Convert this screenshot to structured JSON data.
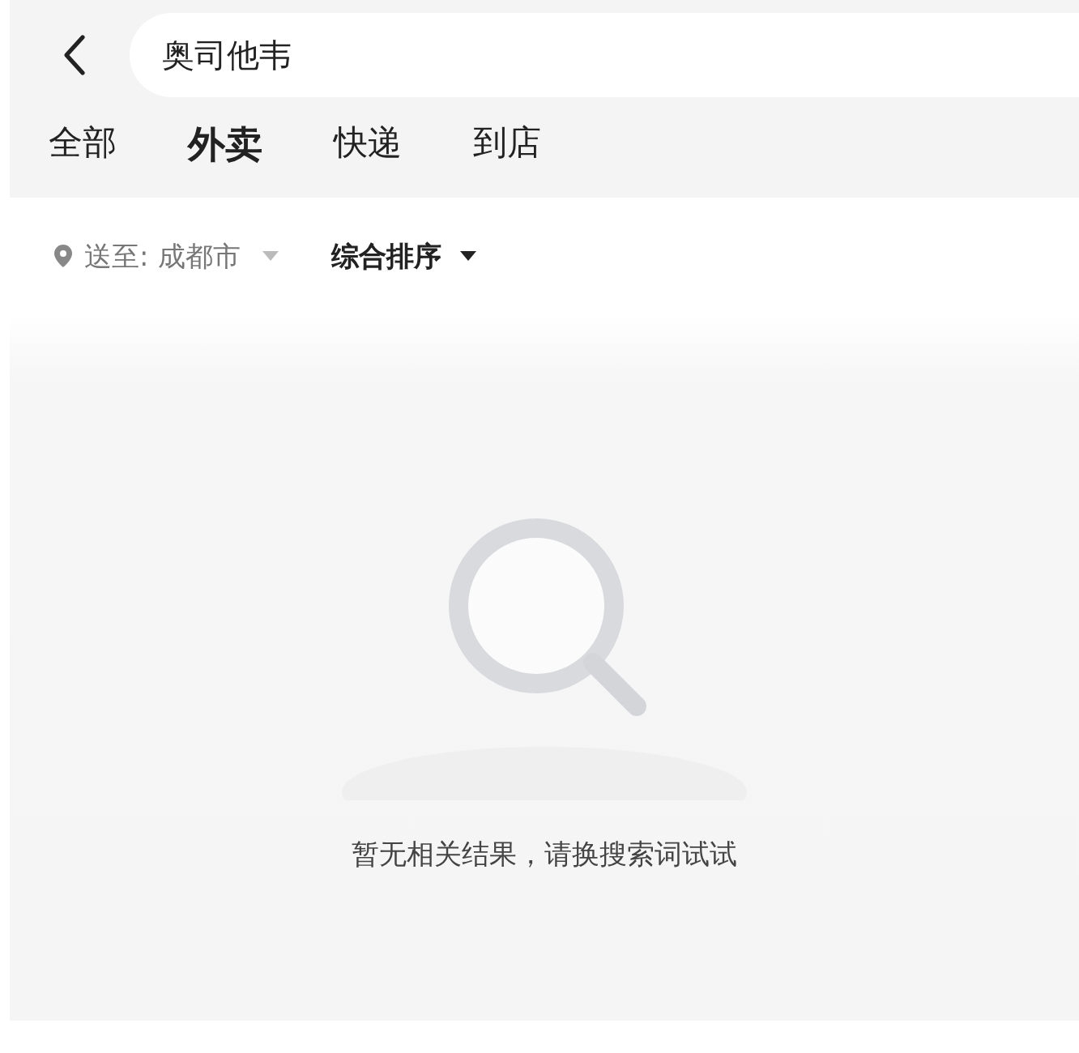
{
  "search": {
    "value": "奥司他韦"
  },
  "tabs": [
    {
      "label": "全部",
      "selected": false
    },
    {
      "label": "外卖",
      "selected": true
    },
    {
      "label": "快递",
      "selected": false
    },
    {
      "label": "到店",
      "selected": false
    }
  ],
  "filters": {
    "location_label": "送至:",
    "location_value": "成都市",
    "sort": "综合排序"
  },
  "empty_state": {
    "message": "暂无相关结果，请换搜索词试试"
  }
}
